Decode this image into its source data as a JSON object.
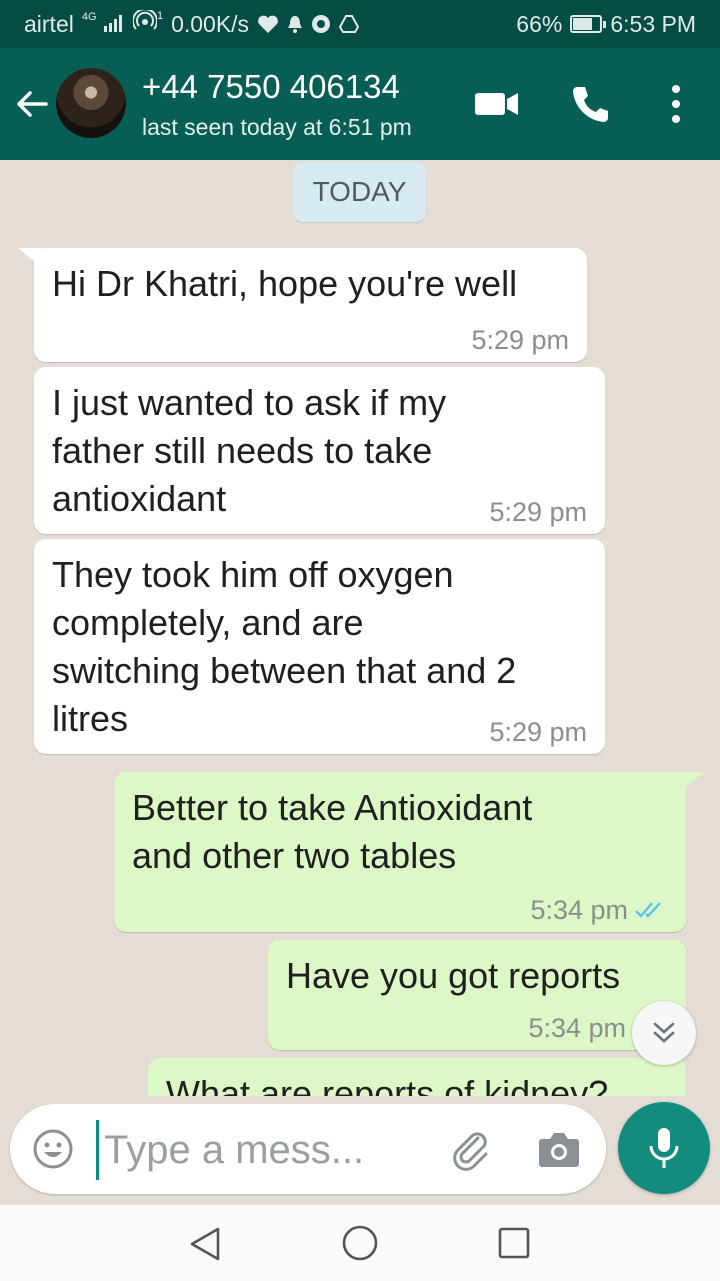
{
  "status_bar": {
    "carrier": "airtel",
    "network": "4G",
    "hotspot_count": "1",
    "speed": "0.00K/s",
    "battery": "66%",
    "battery_level": 0.66,
    "time": "6:53 PM"
  },
  "header": {
    "contact_name": "+44 7550 406134",
    "last_seen": "last seen today at 6:51 pm"
  },
  "chat": {
    "date_chip": "TODAY",
    "messages": [
      {
        "direction": "incoming",
        "lines": [
          "Hi Dr Khatri, hope you're well"
        ],
        "time": "5:29 pm"
      },
      {
        "direction": "incoming",
        "lines": [
          "I just wanted to ask if my",
          "father still needs to take",
          "antioxidant"
        ],
        "time": "5:29 pm"
      },
      {
        "direction": "incoming",
        "lines": [
          "They took him off oxygen",
          "completely, and are",
          "switching between that and 2",
          "litres"
        ],
        "time": "5:29 pm"
      },
      {
        "direction": "outgoing",
        "lines": [
          "Better to take Antioxidant",
          "and other two tables"
        ],
        "time": "5:34 pm",
        "read": true
      },
      {
        "direction": "outgoing",
        "lines": [
          "Have you got reports"
        ],
        "time": "5:34 pm"
      },
      {
        "direction": "outgoing",
        "lines": [
          "What are reports of kidney?"
        ]
      }
    ]
  },
  "composer": {
    "placeholder": "Type a mess..."
  },
  "colors": {
    "status_bar": "#054c44",
    "app_bar": "#075e54",
    "chat_background": "#e4ddd5",
    "incoming_bubble": "#ffffff",
    "outgoing_bubble": "#dcf8c6",
    "read_ticks": "#4fc3f7",
    "mic_button": "#128c7e"
  },
  "icons": [
    "back-arrow-icon",
    "video-call-icon",
    "phone-icon",
    "more-vert-icon",
    "emoji-icon",
    "paperclip-icon",
    "camera-icon",
    "microphone-icon",
    "double-chevron-down-icon",
    "nav-back-icon",
    "nav-home-icon",
    "nav-recent-icon"
  ]
}
